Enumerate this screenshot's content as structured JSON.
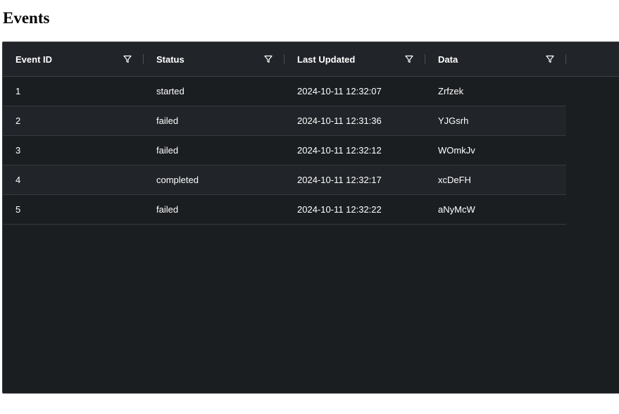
{
  "page": {
    "title": "Events"
  },
  "columns": [
    {
      "key": "event_id",
      "label": "Event ID"
    },
    {
      "key": "status",
      "label": "Status"
    },
    {
      "key": "last_updated",
      "label": "Last Updated"
    },
    {
      "key": "data",
      "label": "Data"
    }
  ],
  "rows": [
    {
      "event_id": "1",
      "status": "started",
      "last_updated": "2024-10-11 12:32:07",
      "data": "Zrfzek"
    },
    {
      "event_id": "2",
      "status": "failed",
      "last_updated": "2024-10-11 12:31:36",
      "data": "YJGsrh"
    },
    {
      "event_id": "3",
      "status": "failed",
      "last_updated": "2024-10-11 12:32:12",
      "data": "WOmkJv"
    },
    {
      "event_id": "4",
      "status": "completed",
      "last_updated": "2024-10-11 12:32:17",
      "data": "xcDeFH"
    },
    {
      "event_id": "5",
      "status": "failed",
      "last_updated": "2024-10-11 12:32:22",
      "data": "aNyMcW"
    }
  ],
  "icons": {
    "column_filter": "filter-icon"
  },
  "colors": {
    "grid_background": "#1b1e21",
    "header_background": "#212428",
    "text": "#ffffff"
  }
}
